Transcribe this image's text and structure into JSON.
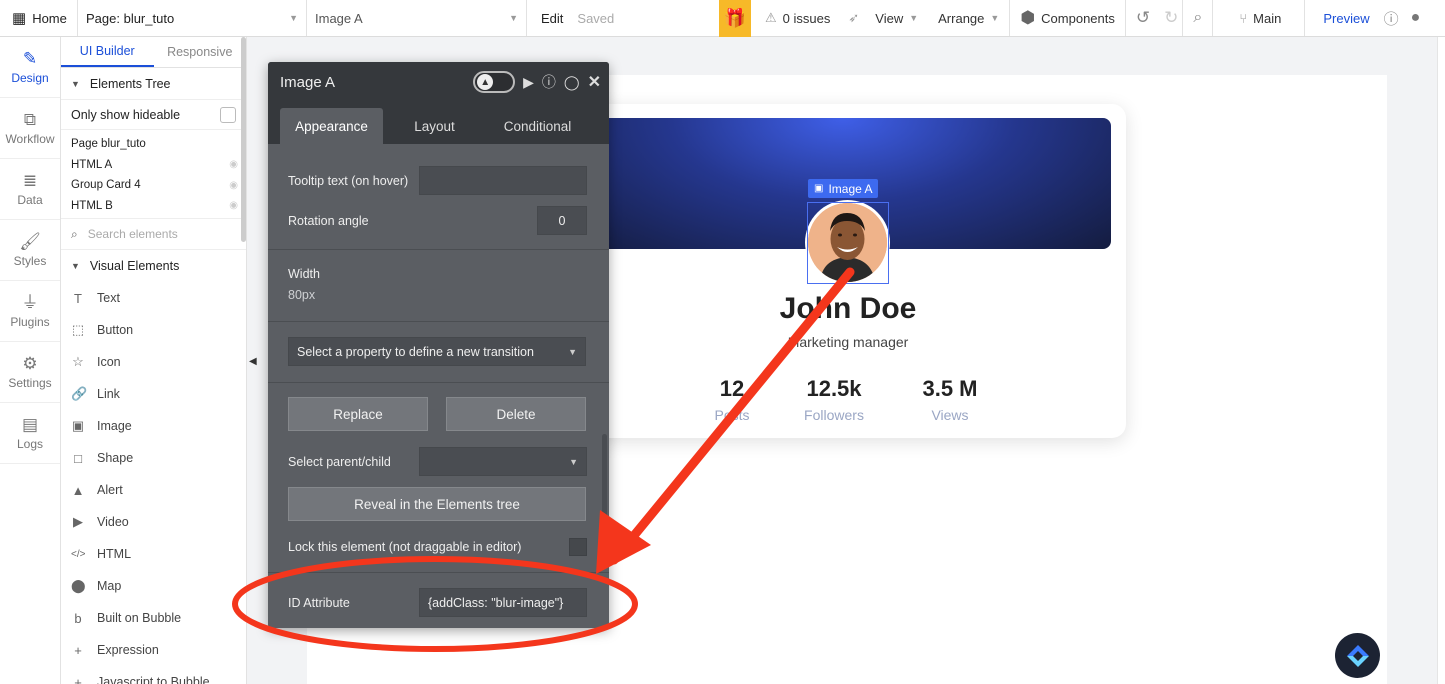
{
  "topbar": {
    "home_label": "Home",
    "page_label": "Page: blur_tuto",
    "element_label": "Image A",
    "edit_label": "Edit",
    "saved_label": "Saved",
    "issues_label": "0 issues",
    "view_label": "View",
    "arrange_label": "Arrange",
    "components_label": "Components",
    "branch_label": "Main",
    "preview_label": "Preview"
  },
  "rail": {
    "items": [
      {
        "label": "Design"
      },
      {
        "label": "Workflow"
      },
      {
        "label": "Data"
      },
      {
        "label": "Styles"
      },
      {
        "label": "Plugins"
      },
      {
        "label": "Settings"
      },
      {
        "label": "Logs"
      }
    ]
  },
  "palette": {
    "tabs": [
      "UI Builder",
      "Responsive"
    ],
    "elements_tree_label": "Elements Tree",
    "only_hideable_label": "Only show hideable",
    "tree": [
      "Page blur_tuto",
      "HTML A",
      "Group Card 4",
      "HTML B"
    ],
    "search_placeholder": "Search elements",
    "visual_elements_label": "Visual Elements",
    "visual_items": [
      "Text",
      "Button",
      "Icon",
      "Link",
      "Image",
      "Shape",
      "Alert",
      "Video",
      "HTML",
      "Map",
      "Built on Bubble",
      "Expression",
      "Javascript to Bubble"
    ]
  },
  "card": {
    "selection_tag": "Image A",
    "name": "John Doe",
    "role": "Marketing manager",
    "stats": [
      {
        "value": "12",
        "label": "Posts"
      },
      {
        "value": "12.5k",
        "label": "Followers"
      },
      {
        "value": "3.5 M",
        "label": "Views"
      }
    ]
  },
  "editor": {
    "title": "Image A",
    "tabs": [
      "Appearance",
      "Layout",
      "Conditional"
    ],
    "tooltip_label": "Tooltip text (on hover)",
    "rotation_label": "Rotation angle",
    "rotation_value": "0",
    "width_label": "Width",
    "width_value": "80px",
    "transition_placeholder": "Select a property to define a new transition",
    "replace_label": "Replace",
    "delete_label": "Delete",
    "parent_child_label": "Select parent/child",
    "reveal_label": "Reveal in the Elements tree",
    "lock_label": "Lock this element (not draggable in editor)",
    "id_label": "ID Attribute",
    "id_value": "{addClass: \"blur-image\"}"
  },
  "annotation": {
    "arrow_color": "#f4361c",
    "ellipse_color": "#f4361c"
  }
}
